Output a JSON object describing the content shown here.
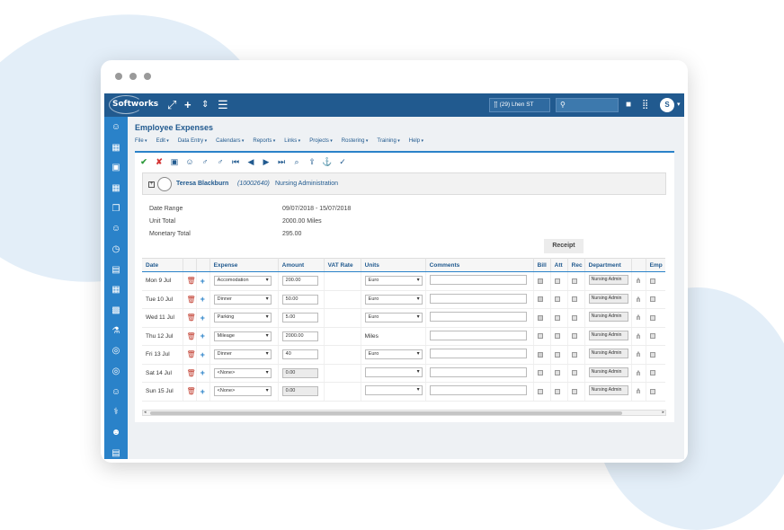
{
  "topbar": {
    "logo": "Softworks",
    "site_selector": "(29) Lhen ST",
    "search_icon": "user-search-icon",
    "avatar": "S"
  },
  "sidebar": {
    "icons": [
      "user-search-icon",
      "calendar-icon",
      "calendar-check-icon",
      "calendar-icon",
      "copy-icon",
      "user-gear-icon",
      "clock-icon",
      "briefcase-icon",
      "calendar-people-icon",
      "calendar-grid-icon",
      "thermometer-icon",
      "lifebuoy-icon",
      "lifebuoy-icon",
      "user-cycle-icon",
      "stethoscope-icon",
      "users-icon",
      "id-card-icon"
    ]
  },
  "page": {
    "title": "Employee Expenses",
    "menu": [
      "File",
      "Edit",
      "Data Entry",
      "Calendars",
      "Reports",
      "Links",
      "Projects",
      "Rostering",
      "Training",
      "Help"
    ]
  },
  "employee": {
    "name": "Teresa Blackburn",
    "id": "(10002640)",
    "department": "Nursing Administration"
  },
  "summary": {
    "date_range_label": "Date Range",
    "date_range": "09/07/2018 - 15/07/2018",
    "unit_total_label": "Unit Total",
    "unit_total": "2000.00 Miles",
    "monetary_total_label": "Monetary Total",
    "monetary_total": "295.00"
  },
  "table": {
    "group_header": "Receipt",
    "headers": {
      "date": "Date",
      "expense": "Expense",
      "amount": "Amount",
      "vat_rate": "VAT Rate",
      "units": "Units",
      "comments": "Comments",
      "bill": "Bill",
      "att": "Att",
      "rec": "Rec",
      "department": "Department",
      "emp": "Emp"
    },
    "rows": [
      {
        "date": "Mon 9 Jul",
        "expense": "Accomodation",
        "amount": "200.00",
        "units": "Euro",
        "units_select": true,
        "bill": true,
        "dept": "Nursing Admin"
      },
      {
        "date": "Tue 10 Jul",
        "expense": "Dinner",
        "amount": "50.00",
        "units": "Euro",
        "units_select": true,
        "bill": true,
        "dept": "Nursing Admin"
      },
      {
        "date": "Wed 11 Jul",
        "expense": "Parking",
        "amount": "5.00",
        "units": "Euro",
        "units_select": true,
        "bill": true,
        "dept": "Nursing Admin"
      },
      {
        "date": "Thu 12 Jul",
        "expense": "Mileage",
        "amount": "2000.00",
        "units": "Miles",
        "units_select": false,
        "bill": false,
        "dept": "Nursing Admin"
      },
      {
        "date": "Fri 13 Jul",
        "expense": "Dinner",
        "amount": "40",
        "units": "Euro",
        "units_select": true,
        "bill": true,
        "dept": "Nursing Admin"
      },
      {
        "date": "Sat 14 Jul",
        "expense": "<None>",
        "amount": "0.00",
        "units": "",
        "units_select": true,
        "bill": false,
        "dept": "Nursing Admin"
      },
      {
        "date": "Sun 15 Jul",
        "expense": "<None>",
        "amount": "0.00",
        "units": "",
        "units_select": true,
        "bill": false,
        "dept": "Nursing Admin"
      }
    ]
  }
}
